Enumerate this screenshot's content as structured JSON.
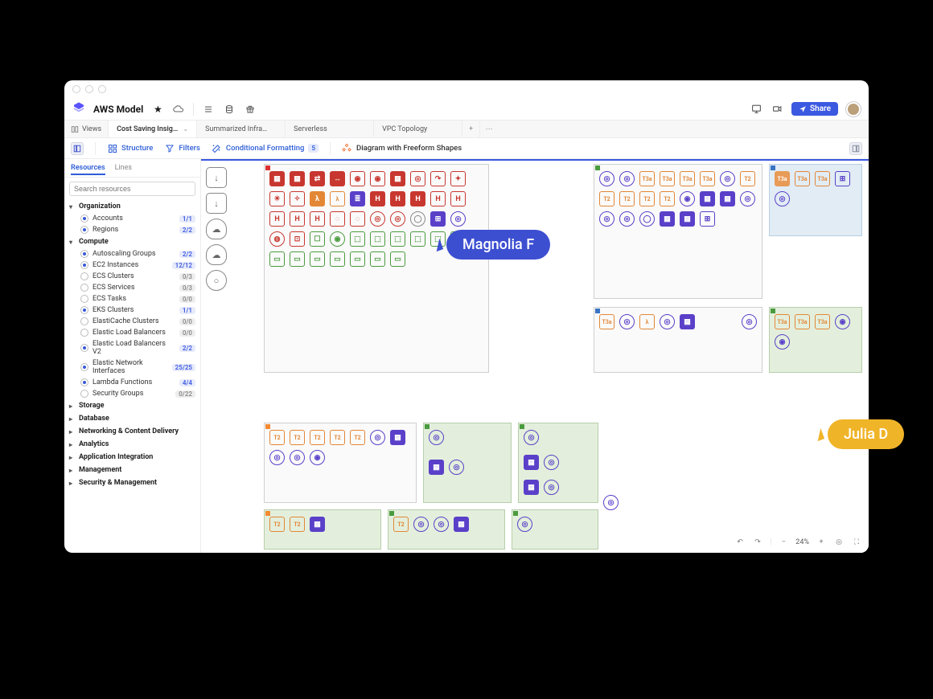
{
  "header": {
    "title": "AWS Model",
    "share_label": "Share"
  },
  "tabs": {
    "views_label": "Views",
    "items": [
      {
        "label": "Cost Saving Insig…",
        "active": true
      },
      {
        "label": "Summarized Infra…",
        "active": false
      },
      {
        "label": "Serverless",
        "active": false
      },
      {
        "label": "VPC Topology",
        "active": false
      }
    ]
  },
  "toolbar": {
    "structure": "Structure",
    "filters": "Filters",
    "conditional_formatting": "Conditional Formatting",
    "cf_count": "5",
    "diagram_label": "Diagram with Freeform Shapes"
  },
  "sidebar": {
    "tabs": [
      "Resources",
      "Lines"
    ],
    "active_tab": 0,
    "search_placeholder": "Search resources",
    "groups": [
      {
        "label": "Organization",
        "expanded": true,
        "items": [
          {
            "label": "Accounts",
            "count": "1/1",
            "on": true
          },
          {
            "label": "Regions",
            "count": "2/2",
            "on": true
          }
        ]
      },
      {
        "label": "Compute",
        "expanded": true,
        "items": [
          {
            "label": "Autoscaling Groups",
            "count": "2/2",
            "on": true
          },
          {
            "label": "EC2 Instances",
            "count": "12/12",
            "on": true
          },
          {
            "label": "ECS Clusters",
            "count": "0/3",
            "on": false
          },
          {
            "label": "ECS Services",
            "count": "0/3",
            "on": false
          },
          {
            "label": "ECS Tasks",
            "count": "0/0",
            "on": false
          },
          {
            "label": "EKS Clusters",
            "count": "1/1",
            "on": true
          },
          {
            "label": "ElastiCache Clusters",
            "count": "0/0",
            "on": false
          },
          {
            "label": "Elastic Load Balancers",
            "count": "0/0",
            "on": false
          },
          {
            "label": "Elastic Load Balancers V2",
            "count": "2/2",
            "on": true
          },
          {
            "label": "Elastic Network Interfaces",
            "count": "25/25",
            "on": true
          },
          {
            "label": "Lambda Functions",
            "count": "4/4",
            "on": true
          },
          {
            "label": "Security Groups",
            "count": "0/22",
            "on": false
          }
        ]
      },
      {
        "label": "Storage",
        "expanded": false,
        "items": []
      },
      {
        "label": "Database",
        "expanded": false,
        "items": []
      },
      {
        "label": "Networking & Content Delivery",
        "expanded": false,
        "items": []
      },
      {
        "label": "Analytics",
        "expanded": false,
        "items": []
      },
      {
        "label": "Application Integration",
        "expanded": false,
        "items": []
      },
      {
        "label": "Management",
        "expanded": false,
        "items": []
      },
      {
        "label": "Security & Management",
        "expanded": false,
        "items": []
      }
    ]
  },
  "cursors": {
    "user1": {
      "name": "Magnolia F",
      "color": "#3d4fd1"
    },
    "user2": {
      "name": "Julia D",
      "color": "#f0b429"
    }
  },
  "footer": {
    "zoom": "24%"
  },
  "canvas_note": "Architecture diagram canvas with multiple AWS resource clusters (greyed, green VPC/subnet, blue availability zones) containing EC2/T2/T3 instance icons (orange), Lambda/ECS icons (purple), and networking icons (red/green)."
}
